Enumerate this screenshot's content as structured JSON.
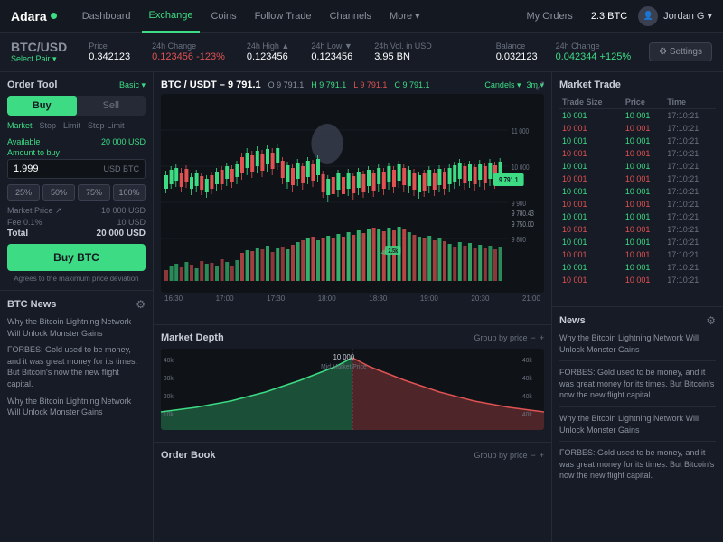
{
  "brand": {
    "name": "Adara",
    "dot_color": "#3ddc84"
  },
  "navbar": {
    "items": [
      {
        "label": "Dashboard",
        "active": false
      },
      {
        "label": "Exchange",
        "active": true
      },
      {
        "label": "Coins",
        "active": false
      },
      {
        "label": "Follow Trade",
        "active": false
      },
      {
        "label": "Channels",
        "active": false
      },
      {
        "label": "More ▾",
        "active": false
      }
    ],
    "orders_label": "My Orders",
    "btc_amount": "2.3 BTC",
    "user_name": "Jordan G ▾"
  },
  "ticker": {
    "pair": "BTC",
    "pair_quote": "/USD",
    "select_label": "Select Pair ▾",
    "price_label": "Price",
    "price_value": "0.342123",
    "change_label": "24h Change",
    "change_value": "0.123456",
    "change_pct": "-123%",
    "high_label": "24h High ▲",
    "high_value": "0.123456",
    "low_label": "24h Low ▼",
    "low_value": "0.123456",
    "vol_label": "24h Vol. in USD",
    "vol_value": "3.95 BN",
    "balance_label": "Balance",
    "balance_value": "0.032123",
    "balance_change_label": "24h Change",
    "balance_change_value": "0.042344",
    "balance_change_pct": "+125%",
    "settings_label": "⚙ Settings"
  },
  "order_tool": {
    "title": "Order Tool",
    "basic_label": "Basic ▾",
    "buy_label": "Buy",
    "sell_label": "Sell",
    "order_types": [
      "Market",
      "Stop",
      "Limit",
      "Stop-Limit"
    ],
    "active_type": "Market",
    "available_label": "Available",
    "available_value": "20 000 USD",
    "amount_label": "Amount to buy",
    "amount_value": "1.999",
    "amount_unit": "USD BTC",
    "pct_buttons": [
      "25%",
      "50%",
      "75%",
      "100%"
    ],
    "market_price_label": "Market Price ↗",
    "market_price_value": "10 000 USD",
    "fee_label": "Fee 0.1%",
    "fee_value": "10 USD",
    "total_label": "Total",
    "total_value": "20 000 USD",
    "buy_btn_label": "Buy BTC",
    "buy_note": "Agrees to the maximum price deviation"
  },
  "btc_news": {
    "title": "BTC News",
    "items": [
      "Why the Bitcoin Lightning Network Will Unlock Monster Gains",
      "FORBES: Gold used to be money, and it was great money for its times. But Bitcoin's now the new flight capital.",
      "Why the Bitcoin Lightning Network Will Unlock Monster Gains"
    ]
  },
  "chart": {
    "title": "BTC / USDT – 9 791.1",
    "o_label": "O",
    "o_value": "9 791.1",
    "h_label": "H",
    "h_value": "9 791.1",
    "l_label": "L",
    "l_value": "9 791.1",
    "c_label": "C",
    "c_value": "9 791.1",
    "view_label": "Candels",
    "interval_label": "3m",
    "y_labels": [
      "11 000",
      "10 000",
      "9 900",
      "9 800",
      "9 750"
    ],
    "x_labels": [
      "16:30",
      "17:00",
      "17:30",
      "18:00",
      "18:30",
      "19:00",
      "20:30",
      "21:00"
    ],
    "current_price": "9 791.1",
    "secondary_price": "9 780.43"
  },
  "market_depth": {
    "title": "Market Depth",
    "group_price_label": "Group by price",
    "mid_price_label": "10 000",
    "mid_price_sublabel": "Mid Market Price",
    "y_left_labels": [
      "40k",
      "30k",
      "20k",
      "10k"
    ],
    "y_right_labels": [
      "40k",
      "40k",
      "40k",
      "40k"
    ]
  },
  "order_book": {
    "title": "Order Book",
    "group_price_label": "Group by price"
  },
  "market_trade": {
    "title": "Market Trade",
    "col_trade_size": "Trade Size",
    "col_price": "Price",
    "col_time": "Time",
    "rows": [
      {
        "size": "10 001",
        "price": "10 001",
        "time": "17:10:21",
        "side": "green"
      },
      {
        "size": "10 001",
        "price": "10 001",
        "time": "17:10:21",
        "side": "red"
      },
      {
        "size": "10 001",
        "price": "10 001",
        "time": "17:10:21",
        "side": "green"
      },
      {
        "size": "10 001",
        "price": "10 001",
        "time": "17:10:21",
        "side": "red"
      },
      {
        "size": "10 001",
        "price": "10 001",
        "time": "17:10:21",
        "side": "green"
      },
      {
        "size": "10 001",
        "price": "10 001",
        "time": "17:10:21",
        "side": "red"
      },
      {
        "size": "10 001",
        "price": "10 001",
        "time": "17:10:21",
        "side": "green"
      },
      {
        "size": "10 001",
        "price": "10 001",
        "time": "17:10:21",
        "side": "red"
      },
      {
        "size": "10 001",
        "price": "10 001",
        "time": "17:10:21",
        "side": "green"
      },
      {
        "size": "10 001",
        "price": "10 001",
        "time": "17:10:21",
        "side": "red"
      },
      {
        "size": "10 001",
        "price": "10 001",
        "time": "17:10:21",
        "side": "green"
      },
      {
        "size": "10 001",
        "price": "10 001",
        "time": "17:10:21",
        "side": "red"
      },
      {
        "size": "10 001",
        "price": "10 001",
        "time": "17:10:21",
        "side": "green"
      },
      {
        "size": "10 001",
        "price": "10 001",
        "time": "17:10:21",
        "side": "red"
      }
    ]
  },
  "news_right": {
    "title": "News",
    "items": [
      "Why the Bitcoin Lightning Network Will Unlock Monster Gains",
      "FORBES: Gold used to be money, and it was great money for its times. But Bitcoin's now the new flight capital.",
      "Why the Bitcoin Lightning Network Will Unlock Monster Gains",
      "FORBES: Gold used to be money, and it was great money for its times. But Bitcoin's now the new flight capital."
    ]
  }
}
